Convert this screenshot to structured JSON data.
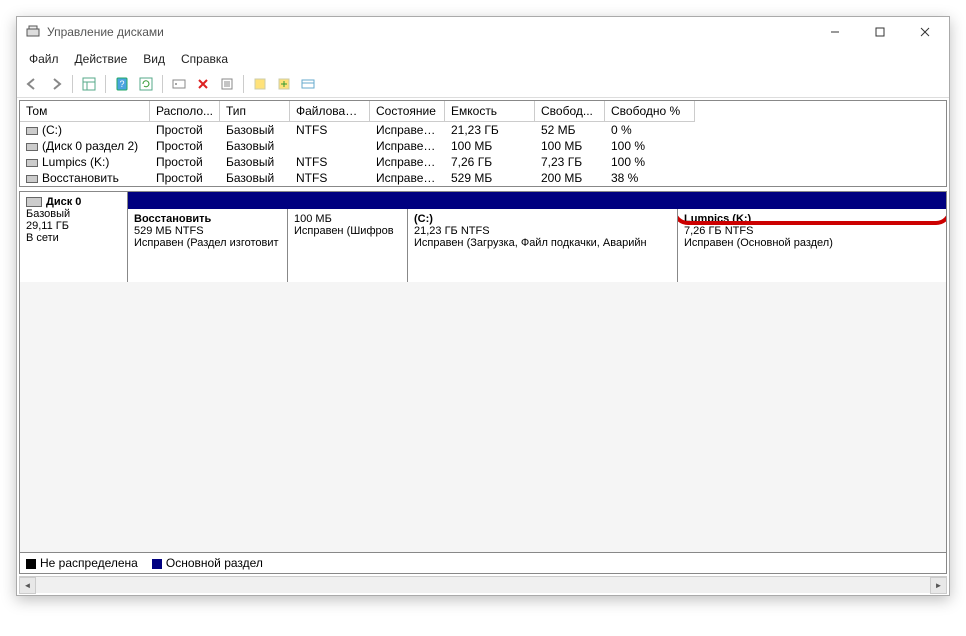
{
  "title": "Управление дисками",
  "menu": {
    "file": "Файл",
    "action": "Действие",
    "view": "Вид",
    "help": "Справка"
  },
  "columns": [
    "Том",
    "Располо...",
    "Тип",
    "Файловая с...",
    "Состояние",
    "Емкость",
    "Свобод...",
    "Свободно %"
  ],
  "rows": [
    {
      "vol": "(C:)",
      "layout": "Простой",
      "type": "Базовый",
      "fs": "NTFS",
      "status": "Исправен...",
      "cap": "21,23 ГБ",
      "free": "52 МБ",
      "pct": "0 %"
    },
    {
      "vol": "(Диск 0 раздел 2)",
      "layout": "Простой",
      "type": "Базовый",
      "fs": "",
      "status": "Исправен...",
      "cap": "100 МБ",
      "free": "100 МБ",
      "pct": "100 %"
    },
    {
      "vol": "Lumpics (K:)",
      "layout": "Простой",
      "type": "Базовый",
      "fs": "NTFS",
      "status": "Исправен...",
      "cap": "7,26 ГБ",
      "free": "7,23 ГБ",
      "pct": "100 %"
    },
    {
      "vol": "Восстановить",
      "layout": "Простой",
      "type": "Базовый",
      "fs": "NTFS",
      "status": "Исправен...",
      "cap": "529 МБ",
      "free": "200 МБ",
      "pct": "38 %"
    }
  ],
  "disk": {
    "name": "Диск 0",
    "type": "Базовый",
    "size": "29,11 ГБ",
    "state": "В сети"
  },
  "partitions": [
    {
      "name": "Восстановить",
      "sub": "529 МБ NTFS",
      "stat": "Исправен (Раздел изготовит"
    },
    {
      "name": "",
      "sub": "100 МБ",
      "stat": "Исправен (Шифров"
    },
    {
      "name": "(C:)",
      "sub": "21,23 ГБ NTFS",
      "stat": "Исправен (Загрузка, Файл подкачки, Аварийн"
    },
    {
      "name": "Lumpics  (K:)",
      "sub": "7,26 ГБ NTFS",
      "stat": "Исправен (Основной раздел)"
    }
  ],
  "legend": {
    "unalloc": "Не распределена",
    "primary": "Основной раздел"
  }
}
